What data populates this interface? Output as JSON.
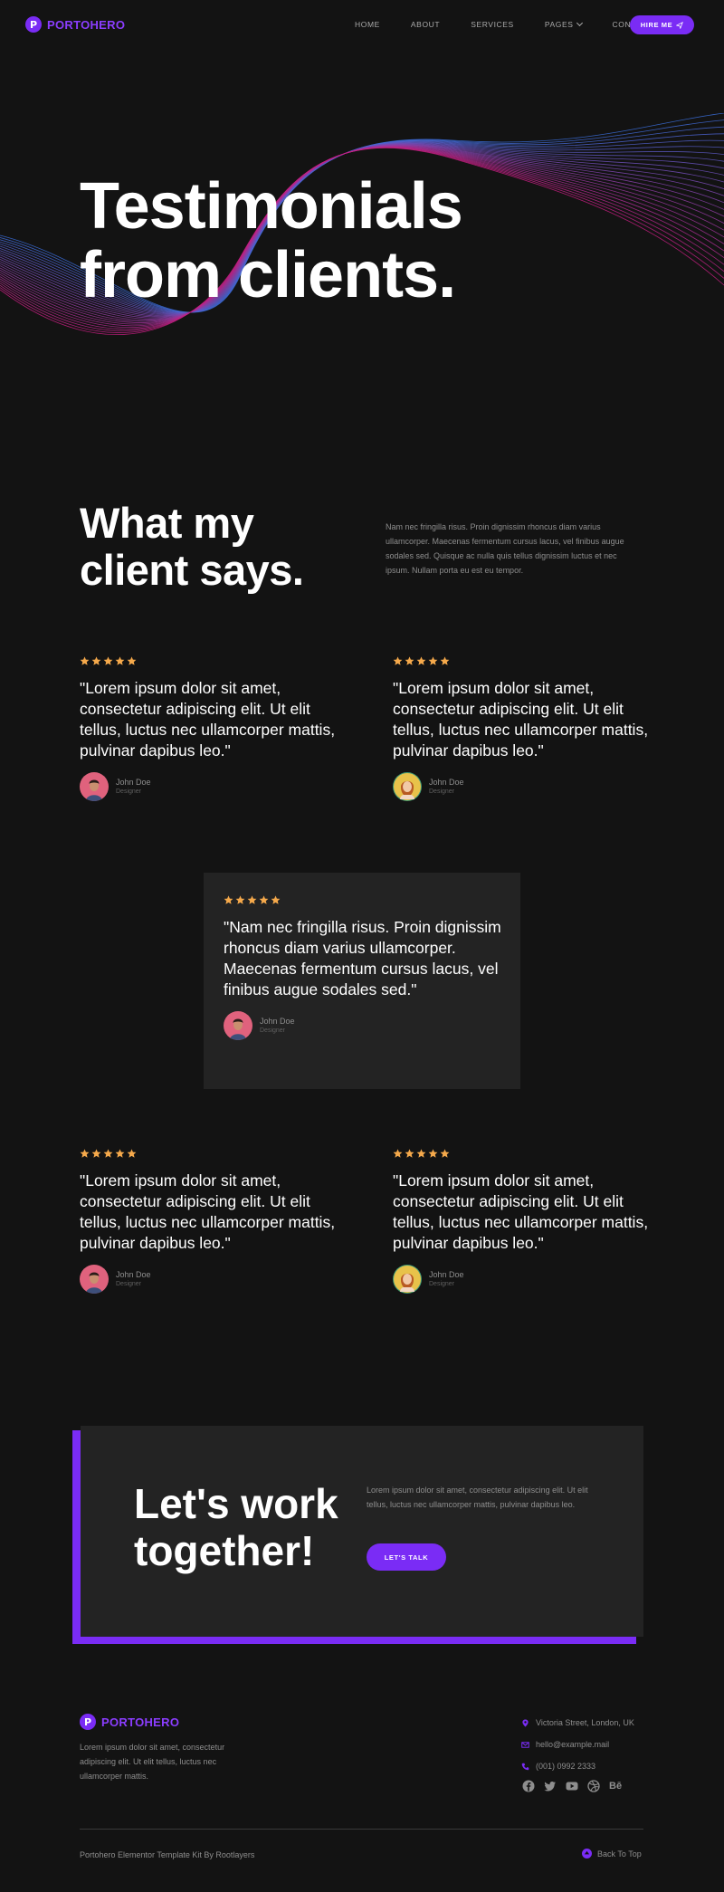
{
  "brand": {
    "logo_letter": "P",
    "name": "PORTOHERO",
    "accent": "#7a2cf5"
  },
  "nav": {
    "items": [
      {
        "label": "HOME"
      },
      {
        "label": "ABOUT"
      },
      {
        "label": "SERVICES"
      },
      {
        "label": "PAGES",
        "has_dropdown": true
      },
      {
        "label": "CONTACT"
      }
    ],
    "hire_label": "HIRE ME",
    "hire_icon": "paper-plane-icon"
  },
  "hero": {
    "title_line1": "Testimonials",
    "title_line2": "from clients."
  },
  "clients_section": {
    "title_line1": "What my",
    "title_line2": "client says.",
    "description": "Nam nec fringilla risus. Proin dignissim rhoncus diam varius ullamcorper. Maecenas fermentum cursus lacus, vel finibus augue sodales sed. Quisque ac nulla quis tellus dignissim luctus et nec ipsum. Nullam porta eu est eu tempor."
  },
  "testimonials": [
    {
      "rating": 5,
      "quote": "\"Lorem ipsum dolor sit amet, consectetur adipiscing elit. Ut elit tellus, luctus nec ullamcorper mattis, pulvinar dapibus leo.\"",
      "name": "John Doe",
      "role": "Designer",
      "avatar": "male"
    },
    {
      "rating": 5,
      "quote": "\"Lorem ipsum dolor sit amet, consectetur adipiscing elit. Ut elit tellus, luctus nec ullamcorper mattis, pulvinar dapibus leo.\"",
      "name": "John Doe",
      "role": "Designer",
      "avatar": "female"
    },
    {
      "rating": 5,
      "quote": "\"Nam nec fringilla risus. Proin dignissim rhoncus diam varius ullamcorper. Maecenas fermentum cursus lacus, vel finibus augue sodales sed.\"",
      "name": "John Doe",
      "role": "Designer",
      "avatar": "male"
    },
    {
      "rating": 5,
      "quote": "\"Lorem ipsum dolor sit amet, consectetur adipiscing elit. Ut elit tellus, luctus nec ullamcorper mattis, pulvinar dapibus leo.\"",
      "name": "John Doe",
      "role": "Designer",
      "avatar": "male"
    },
    {
      "rating": 5,
      "quote": "\"Lorem ipsum dolor sit amet, consectetur adipiscing elit. Ut elit tellus, luctus nec ullamcorper mattis, pulvinar dapibus leo.\"",
      "name": "John Doe",
      "role": "Designer",
      "avatar": "female"
    }
  ],
  "cta": {
    "title_line1": "Let's work",
    "title_line2": "together!",
    "description": "Lorem ipsum dolor sit amet, consectetur adipiscing elit. Ut elit tellus, luctus nec ullamcorper mattis, pulvinar dapibus leo.",
    "button_label": "LET'S TALK"
  },
  "footer": {
    "brand_name": "PORTOHERO",
    "description": "Lorem ipsum dolor sit amet, consectetur adipiscing elit. Ut elit tellus, luctus nec ullamcorper mattis.",
    "address": "Victoria Street, London, UK",
    "email": "hello@example.mail",
    "phone": "(001) 0992 2333",
    "social_icons": [
      "facebook-icon",
      "twitter-icon",
      "youtube-icon",
      "dribbble-icon",
      "behance-icon"
    ],
    "behance_text": "Bē",
    "copyright": "Portohero Elementor Template Kit By Rootlayers",
    "back_to_top": "Back To Top"
  },
  "colors": {
    "background": "#131313",
    "card": "#232323",
    "star": "#f5a94b",
    "muted_text": "#8e8e8e"
  }
}
